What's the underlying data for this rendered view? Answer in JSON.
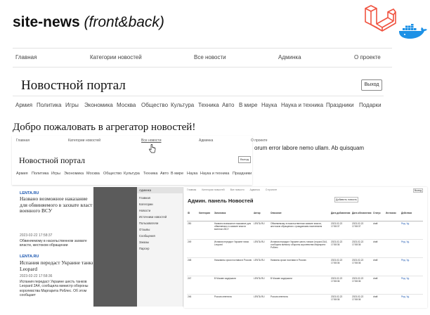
{
  "header": {
    "title_bold": "site-news",
    "title_italic": "(front&back)"
  },
  "nav": [
    "Главная",
    "Категории новостей",
    "Все новости",
    "Админка",
    "О проекте"
  ],
  "portal_title": "Новостной портал",
  "logout_label": "Выход",
  "categories": [
    "Армия",
    "Политика",
    "Игры",
    "Экономика",
    "Москва",
    "Общество",
    "Культура",
    "Техника",
    "Авто",
    "В мире",
    "Наука",
    "Наука и техника",
    "Праздники",
    "Подарки"
  ],
  "welcome": "Добро пожаловать в агрегатор новостей!",
  "lorem_fragment": "orum error labore nemo ullam. Ab quisquam",
  "news": [
    {
      "source": "LENTA.RU",
      "title": "Названо возможное наказание для обвиняемого в захвате власти военного ВСУ",
      "date": "2023-02-22 17:58:37",
      "desc": "Обвиняемому в насильственном захвате власти, жестоком обращении"
    },
    {
      "source": "LENTA.RU",
      "title": "Испания передаст Украине танки Leopard",
      "date": "2023-02-22 17:58:36",
      "desc": "Испания передаст Украине шесть танков Leopard 2A4, сообщила министр обороны королевства Маргарита Роблес. Об этом сообщает"
    }
  ],
  "admin": {
    "sidebar": [
      "Админка",
      "Главная",
      "Категории",
      "Новости",
      "Источники новостей",
      "Пользователи",
      "Отзывы",
      "Сообщения",
      "Заказы",
      "Парсер"
    ],
    "nav": [
      "Главная",
      "Категории новостей",
      "Все новости",
      "Админка",
      "О проекте"
    ],
    "logout": "Выход",
    "title": "Админ. панель Новостей",
    "add_button": "Добавить новость",
    "columns": [
      "ID",
      "Категория",
      "Заголовок",
      "Автор",
      "Описание",
      "Дата добавления",
      "Дата обновления",
      "Статус",
      "Источник",
      "Действия"
    ],
    "rows": [
      {
        "id": "250",
        "cat": "",
        "title": "Названо возможное наказание для обвиняемого в захвате власти военного ВСУ",
        "author": "LENTA.RU",
        "desc": "Обвиняемому в насильственном захвате власти, жестоком обращении с гражданским населением",
        "created": "2023-02-22 17:58:37",
        "updated": "2023-02-22 17:58:37",
        "status": "draft",
        "source": "",
        "actions": "Ред. Уд."
      },
      {
        "id": "249",
        "cat": "",
        "title": "Испания передаст Украине танки Leopard",
        "author": "LENTA.RU",
        "desc": "Испания передаст Украине шесть танков Leopard 2A4, сообщила министр обороны королевства Маргарита Роблес",
        "created": "2023-02-22 17:58:36",
        "updated": "2023-02-22 17:58:36",
        "status": "draft",
        "source": "",
        "actions": "Ред. Уд."
      },
      {
        "id": "248",
        "cat": "",
        "title": "Называны сроки поставки в Россию",
        "author": "LENTA.RU",
        "desc": "Названы сроки поставки в Россию",
        "created": "2023-02-22 17:58:36",
        "updated": "2023-02-22 17:58:36",
        "status": "draft",
        "source": "",
        "actions": "Ред. Уд."
      },
      {
        "id": "247",
        "cat": "",
        "title": "В Москве задержали",
        "author": "LENTA.RU",
        "desc": "В Москве задержали",
        "created": "2023-02-22 17:58:36",
        "updated": "2023-02-22 17:58:36",
        "status": "draft",
        "source": "",
        "actions": "Ред. Уд."
      },
      {
        "id": "246",
        "cat": "",
        "title": "Россия ответила",
        "author": "LENTA.RU",
        "desc": "Россия ответила",
        "created": "2023-02-22 17:58:36",
        "updated": "2023-02-22 17:58:36",
        "status": "draft",
        "source": "",
        "actions": "Ред. Уд."
      }
    ]
  },
  "colors": {
    "laravel": "#f05340",
    "docker": "#1d91e6",
    "link": "#1a56b0"
  }
}
